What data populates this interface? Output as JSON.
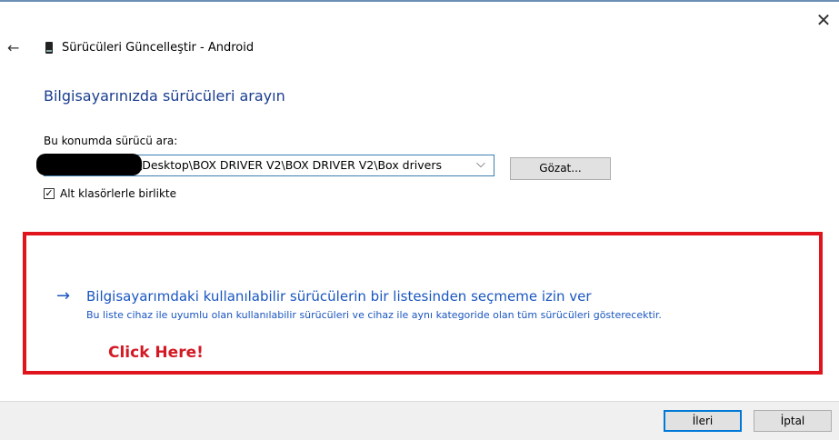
{
  "window": {
    "title": "Sürücüleri Güncelleştir - Android",
    "close_icon": "close-icon",
    "back_icon": "back-arrow-icon"
  },
  "page": {
    "heading": "Bilgisayarınızda sürücüleri arayın",
    "search_label": "Bu konumda sürücü ara:",
    "path_value": "\\Desktop\\BOX DRIVER V2\\BOX DRIVER V2\\Box drivers",
    "browse_label": "Gözat...",
    "subfolders_label": "Alt klasörlerle birlikte",
    "subfolders_checked": true
  },
  "pick_option": {
    "arrow": "→",
    "title": "Bilgisayarımdaki kullanılabilir sürücülerin bir listesinden seçmeme izin ver",
    "description": "Bu liste cihaz ile uyumlu olan kullanılabilir sürücüleri ve cihaz ile aynı kategoride olan tüm sürücüleri gösterecektir.",
    "annotation": "Click Here!"
  },
  "footer": {
    "next_label": "İleri",
    "cancel_label": "İptal"
  },
  "colors": {
    "accent": "#1a56c0",
    "highlight": "#e0141c"
  }
}
